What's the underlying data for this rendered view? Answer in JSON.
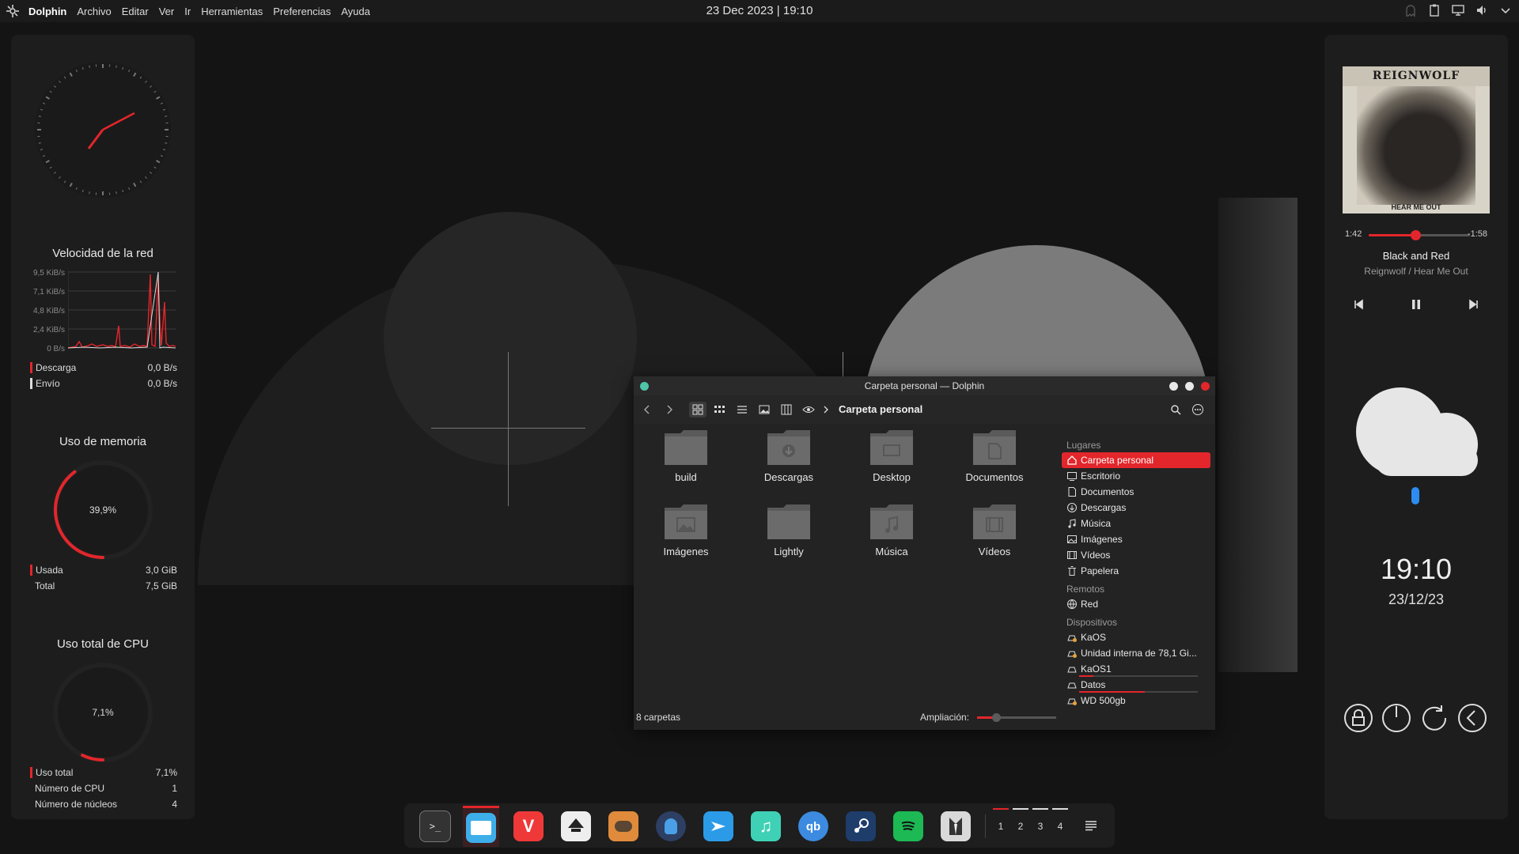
{
  "topbar": {
    "app_name": "Dolphin",
    "menu": [
      "Archivo",
      "Editar",
      "Ver",
      "Ir",
      "Herramientas",
      "Preferencias",
      "Ayuda"
    ],
    "datetime": "23 Dec 2023 | 19:10",
    "tray_icons": [
      "ghost-icon",
      "clipboard-icon",
      "display-icon",
      "volume-icon",
      "chevron-down-icon"
    ]
  },
  "left_panel": {
    "network": {
      "title": "Velocidad de la red",
      "y_labels": [
        "9,5 KiB/s",
        "7,1 KiB/s",
        "4,8 KiB/s",
        "2,4 KiB/s",
        "0 B/s"
      ],
      "download_label": "Descarga",
      "download_value": "0,0 B/s",
      "upload_label": "Envío",
      "upload_value": "0,0 B/s"
    },
    "memory": {
      "title": "Uso de memoria",
      "percent_text": "39,9%",
      "percent": 39.9,
      "used_label": "Usada",
      "used_value": "3,0 GiB",
      "total_label": "Total",
      "total_value": "7,5 GiB"
    },
    "cpu": {
      "title": "Uso total de CPU",
      "percent_text": "7,1%",
      "percent": 7.1,
      "usage_label": "Uso total",
      "usage_value": "7,1%",
      "cpus_label": "Número de CPU",
      "cpus_value": "1",
      "cores_label": "Número de núcleos",
      "cores_value": "4"
    }
  },
  "dolphin": {
    "title": "Carpeta personal — Dolphin",
    "breadcrumb": "Carpeta personal",
    "folders": [
      {
        "name": "build",
        "icon": "folder-icon"
      },
      {
        "name": "Descargas",
        "icon": "folder-download-icon"
      },
      {
        "name": "Desktop",
        "icon": "folder-desktop-icon"
      },
      {
        "name": "Documentos",
        "icon": "folder-documents-icon"
      },
      {
        "name": "Imágenes",
        "icon": "folder-pictures-icon"
      },
      {
        "name": "Lightly",
        "icon": "folder-icon"
      },
      {
        "name": "Música",
        "icon": "folder-music-icon"
      },
      {
        "name": "Vídeos",
        "icon": "folder-videos-icon"
      }
    ],
    "status": "8 carpetas",
    "zoom_label": "Ampliación:",
    "zoom_level": 0.24,
    "places": {
      "section_places": "Lugares",
      "items": [
        "Carpeta personal",
        "Escritorio",
        "Documentos",
        "Descargas",
        "Música",
        "Imágenes",
        "Vídeos",
        "Papelera"
      ],
      "section_remote": "Remotos",
      "remote_items": [
        "Red"
      ],
      "section_devices": "Dispositivos",
      "devices": [
        {
          "name": "KaOS",
          "usage": null
        },
        {
          "name": "Unidad interna de 78,1 Gi...",
          "usage": null
        },
        {
          "name": "KaOS1",
          "usage": 0.12
        },
        {
          "name": "Datos",
          "usage": 0.55
        },
        {
          "name": "WD 500gb",
          "usage": null
        }
      ]
    }
  },
  "right_panel": {
    "album_band": "REIGNWOLF",
    "album_sub": "HEAR ME OUT",
    "elapsed": "1:42",
    "remaining": "-1:58",
    "progress": 0.46,
    "song_title": "Black and Red",
    "song_artist": "Reignwolf / Hear Me Out",
    "clock": "19:10",
    "date": "23/12/23",
    "weather_icon": "cloud-rain-icon",
    "session_icons": [
      "lock-icon",
      "power-icon",
      "restart-icon",
      "logout-icon"
    ]
  },
  "dock": {
    "apps": [
      "terminal-icon",
      "dolphin-icon",
      "vivaldi-icon",
      "inkscape-icon",
      "gimp-icon",
      "kleopatra-icon",
      "kdeconnect-icon",
      "music-icon",
      "qbittorrent-icon",
      "steam-icon",
      "spotify-icon",
      "tuxedo-icon"
    ],
    "workspaces": [
      "1",
      "2",
      "3",
      "4"
    ]
  },
  "colors": {
    "accent": "#e3262b",
    "panel": "#1d1d1d",
    "background": "#141414"
  }
}
